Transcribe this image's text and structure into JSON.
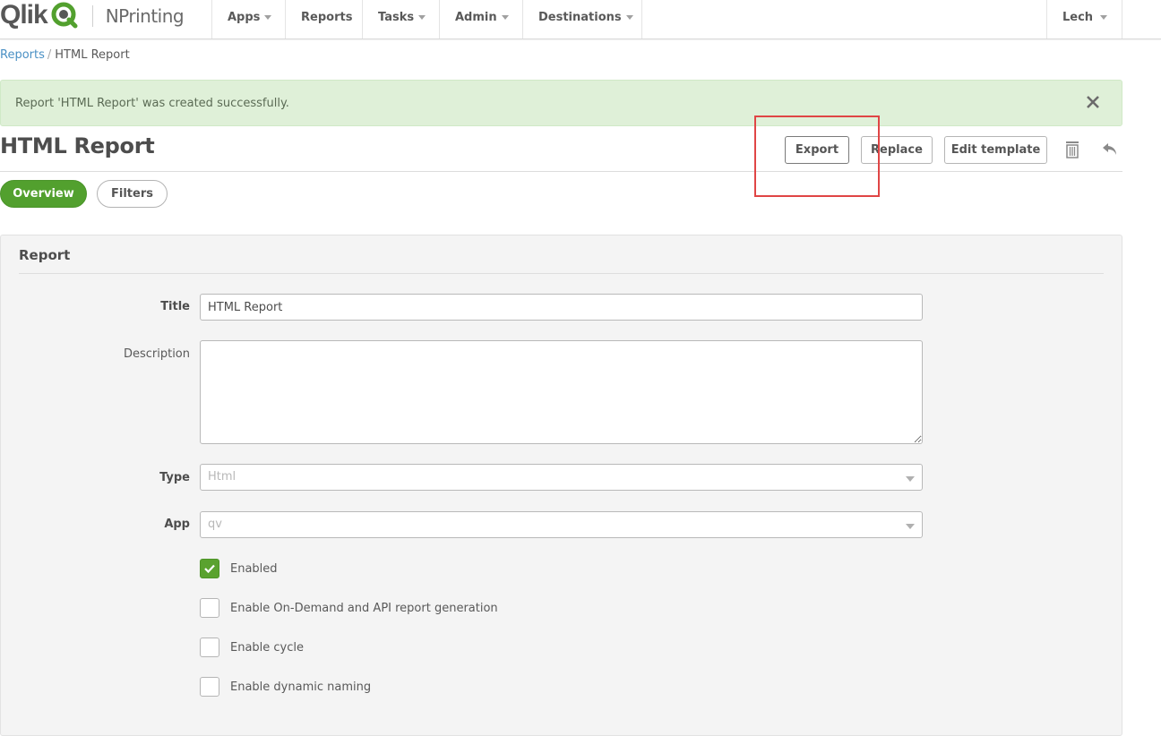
{
  "brand": {
    "logo_text": "Qlik",
    "product": "NPrinting"
  },
  "nav": {
    "items": [
      {
        "label": "Apps",
        "has_caret": true
      },
      {
        "label": "Reports",
        "has_caret": false
      },
      {
        "label": "Tasks",
        "has_caret": true
      },
      {
        "label": "Admin",
        "has_caret": true
      },
      {
        "label": "Destinations",
        "has_caret": true
      }
    ],
    "user": "Lech"
  },
  "breadcrumb": {
    "parent": "Reports",
    "separator": "/",
    "current": "HTML Report"
  },
  "alert": {
    "message": "Report 'HTML Report' was created successfully.",
    "close_icon": "close-icon"
  },
  "header": {
    "title": "HTML Report",
    "buttons": {
      "export": "Export",
      "replace": "Replace",
      "edit_template": "Edit template"
    },
    "icons": {
      "delete": "trash-icon",
      "back": "back-arrow-icon"
    }
  },
  "tabs": [
    {
      "label": "Overview",
      "active": true
    },
    {
      "label": "Filters",
      "active": false
    }
  ],
  "panel": {
    "title": "Report",
    "fields": {
      "title": {
        "label": "Title",
        "value": "HTML Report"
      },
      "description": {
        "label": "Description",
        "value": ""
      },
      "type": {
        "label": "Type",
        "value": "Html"
      },
      "app": {
        "label": "App",
        "value": "qv"
      }
    },
    "checkboxes": [
      {
        "label": "Enabled",
        "checked": true
      },
      {
        "label": "Enable On-Demand and API report generation",
        "checked": false
      },
      {
        "label": "Enable cycle",
        "checked": false
      },
      {
        "label": "Enable dynamic naming",
        "checked": false
      }
    ]
  },
  "colors": {
    "accent_green": "#52a02e",
    "alert_bg": "#dff0d8",
    "link_blue": "#4a90c4",
    "highlight_red": "#e04545"
  }
}
